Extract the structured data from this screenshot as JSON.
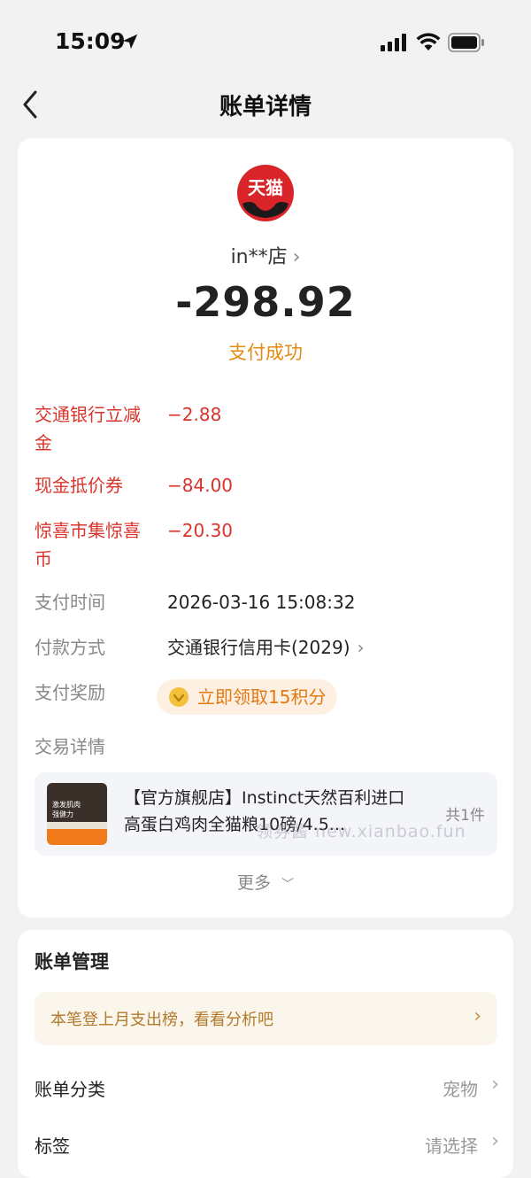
{
  "status_bar": {
    "time": "15:09"
  },
  "nav": {
    "title": "账单详情"
  },
  "merchant": {
    "logo_text": "天猫",
    "name": "in**店",
    "amount": "-298.92",
    "status": "支付成功"
  },
  "discounts": [
    {
      "label": "交通银行立减金",
      "value": "−2.88"
    },
    {
      "label": "现金抵价券",
      "value": "−84.00"
    },
    {
      "label": "惊喜市集惊喜币",
      "value": "−20.30"
    }
  ],
  "details": {
    "pay_time_label": "支付时间",
    "pay_time": "2026-03-16 15:08:32",
    "pay_method_label": "付款方式",
    "pay_method": "交通银行信用卡(2029)",
    "reward_label": "支付奖励",
    "reward_text": "立即领取15积分",
    "trade_label": "交易详情"
  },
  "product": {
    "title": "【官方旗舰店】Instinct天然百利进口高蛋白鸡肉全猫粮10磅/4.5...",
    "count": "共1件",
    "image_text_1": "激发肌肉",
    "image_text_2": "强健力",
    "watermark": "领券酱 new.xianbao.fun"
  },
  "more_label": "更多",
  "manage": {
    "title": "账单管理",
    "insight": "本笔登上月支出榜，看看分析吧",
    "category_label": "账单分类",
    "category_value": "宠物",
    "tag_label": "标签",
    "tag_value": "请选择"
  },
  "colors": {
    "accent_orange": "#e58a12",
    "discount_red": "#d9342b",
    "tmall_red": "#d9252a"
  }
}
